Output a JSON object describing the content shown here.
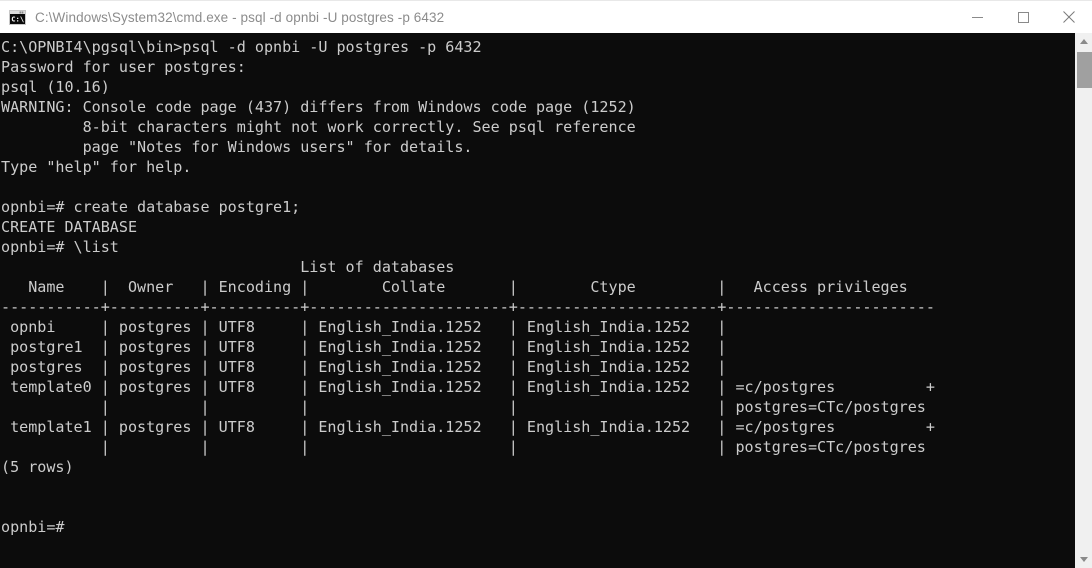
{
  "window": {
    "title": "C:\\Windows\\System32\\cmd.exe - psql  -d opnbi -U postgres -p 6432",
    "icon": "cmd-console-icon",
    "background_color": "#0c0c0c",
    "text_color": "#cccccc",
    "titlebar_background": "#ffffff",
    "titlebar_text_color": "#8c8c8c"
  },
  "controls": {
    "minimize_label": "Minimize",
    "maximize_label": "Maximize",
    "close_label": "Close"
  },
  "scrollbar": {
    "up_arrow_label": "Scroll up",
    "down_arrow_label": "Scroll down",
    "thumb_label": "Scroll thumb"
  },
  "terminal": {
    "prompt": "opnbi=#",
    "lines": [
      "C:\\OPNBI4\\pgsql\\bin>psql -d opnbi -U postgres -p 6432",
      "Password for user postgres:",
      "psql (10.16)",
      "WARNING: Console code page (437) differs from Windows code page (1252)",
      "         8-bit characters might not work correctly. See psql reference",
      "         page \"Notes for Windows users\" for details.",
      "Type \"help\" for help.",
      "",
      "opnbi=# create database postgre1;",
      "CREATE DATABASE",
      "opnbi=# \\list",
      "                                 List of databases",
      "   Name    |  Owner   | Encoding |        Collate       |        Ctype         |   Access privileges",
      "-----------+----------+----------+----------------------+----------------------+-----------------------",
      " opnbi     | postgres | UTF8     | English_India.1252   | English_India.1252   |",
      " postgre1  | postgres | UTF8     | English_India.1252   | English_India.1252   |",
      " postgres  | postgres | UTF8     | English_India.1252   | English_India.1252   |",
      " template0 | postgres | UTF8     | English_India.1252   | English_India.1252   | =c/postgres          +",
      "           |          |          |                      |                      | postgres=CTc/postgres",
      " template1 | postgres | UTF8     | English_India.1252   | English_India.1252   | =c/postgres          +",
      "           |          |          |                      |                      | postgres=CTc/postgres",
      "(5 rows)",
      "",
      "",
      "opnbi=#"
    ],
    "command_entered": "create database postgre1;",
    "command_result": "CREATE DATABASE",
    "meta_command": "\\list",
    "table_title": "List of databases",
    "table_headers": [
      "Name",
      "Owner",
      "Encoding",
      "Collate",
      "Ctype",
      "Access privileges"
    ],
    "table_rows": [
      {
        "name": "opnbi",
        "owner": "postgres",
        "encoding": "UTF8",
        "collate": "English_India.1252",
        "ctype": "English_India.1252",
        "access_privileges": ""
      },
      {
        "name": "postgre1",
        "owner": "postgres",
        "encoding": "UTF8",
        "collate": "English_India.1252",
        "ctype": "English_India.1252",
        "access_privileges": ""
      },
      {
        "name": "postgres",
        "owner": "postgres",
        "encoding": "UTF8",
        "collate": "English_India.1252",
        "ctype": "English_India.1252",
        "access_privileges": ""
      },
      {
        "name": "template0",
        "owner": "postgres",
        "encoding": "UTF8",
        "collate": "English_India.1252",
        "ctype": "English_India.1252",
        "access_privileges": "=c/postgres          +\npostgres=CTc/postgres"
      },
      {
        "name": "template1",
        "owner": "postgres",
        "encoding": "UTF8",
        "collate": "English_India.1252",
        "ctype": "English_India.1252",
        "access_privileges": "=c/postgres          +\npostgres=CTc/postgres"
      }
    ],
    "row_count_text": "(5 rows)",
    "psql_version": "psql (10.16)",
    "warning_text": "WARNING: Console code page (437) differs from Windows code page (1252)"
  }
}
